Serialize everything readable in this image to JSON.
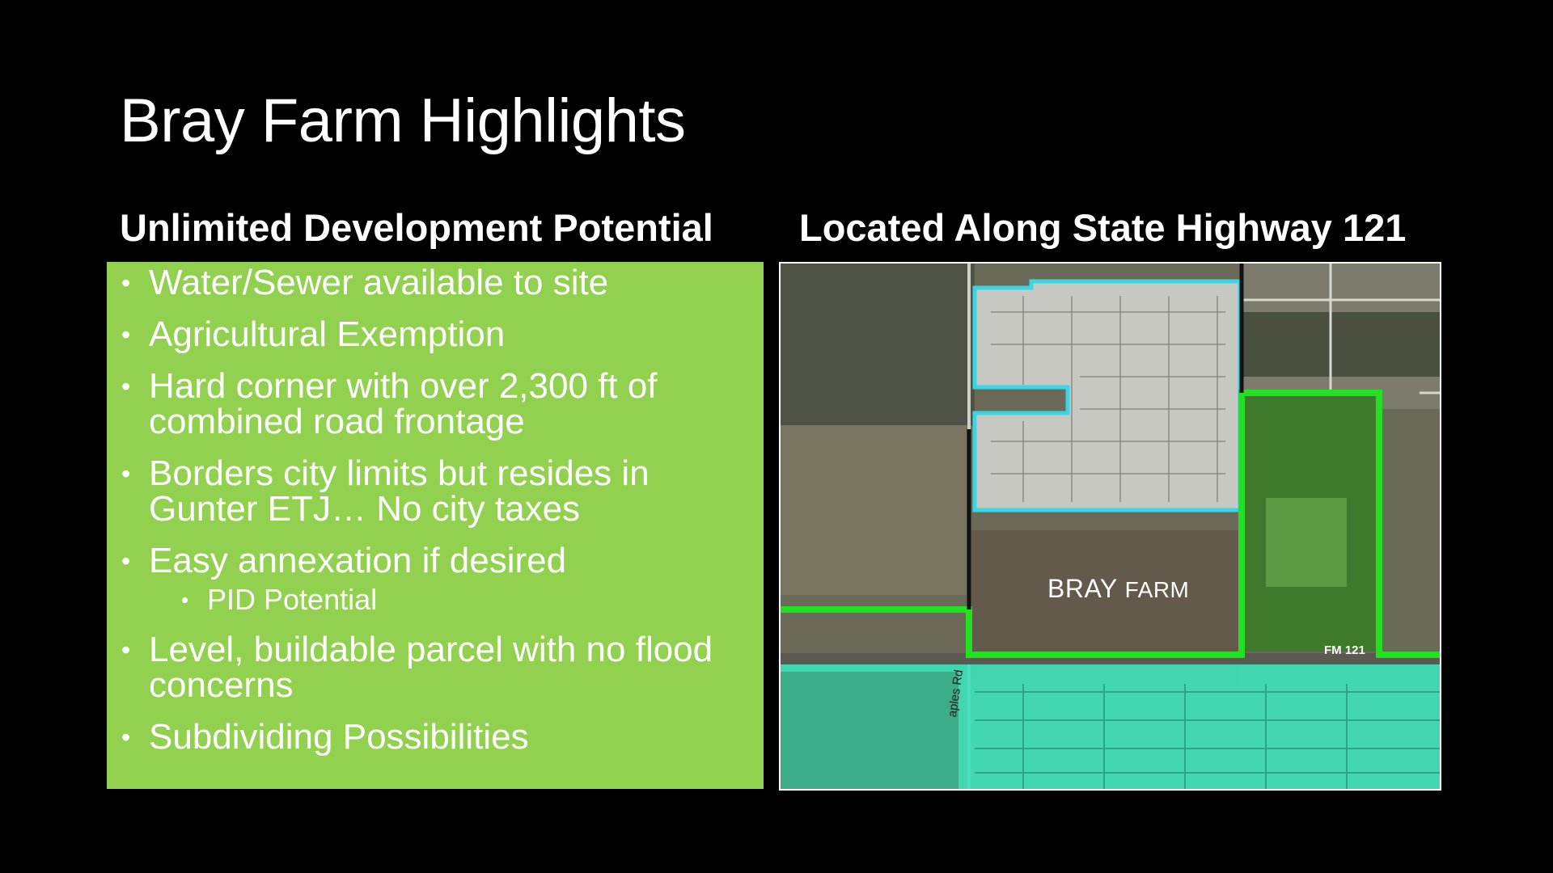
{
  "title": "Bray Farm Highlights",
  "left_column": {
    "heading": "Unlimited Development Potential",
    "box_color": "#92d050",
    "bullets": [
      {
        "text": "Water/Sewer available to site",
        "level": 1
      },
      {
        "text": "Agricultural Exemption",
        "level": 1
      },
      {
        "text": "Hard corner with over 2,300 ft of combined road frontage",
        "level": 1
      },
      {
        "text": "Borders city limits but resides in Gunter ETJ… No city taxes",
        "level": 1
      },
      {
        "text": "Easy annexation if desired",
        "level": 1
      },
      {
        "text": "PID Potential",
        "level": 2
      },
      {
        "text": "Level, buildable parcel with no flood concerns",
        "level": 1
      },
      {
        "text": "Subdividing Possibilities",
        "level": 1
      }
    ]
  },
  "right_column": {
    "heading": "Located Along State Highway 121",
    "map": {
      "parcel_label_main": "BRAY",
      "parcel_label_suffix": "FARM",
      "highway_label": "FM 121",
      "road_label": "aples Rd",
      "boundary_color": "#22e022",
      "subdivision_color": "#3fe0b8"
    }
  },
  "bullet_glyph": "•"
}
